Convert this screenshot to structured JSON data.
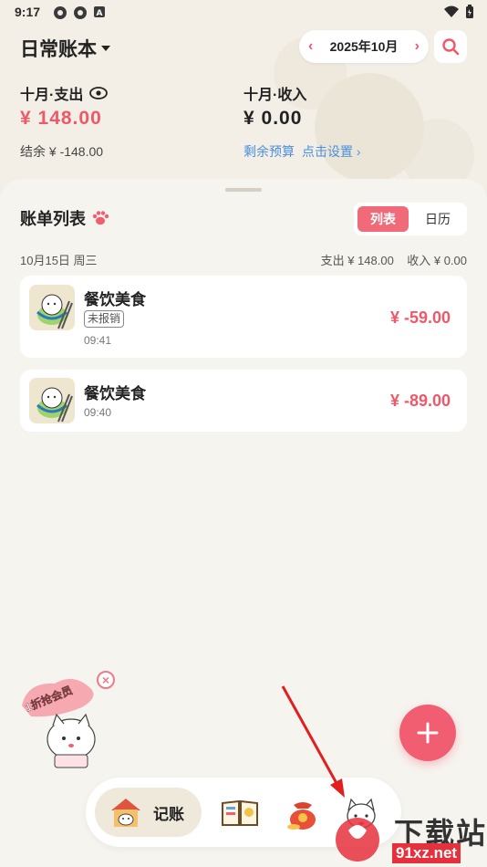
{
  "status_bar": {
    "time": "9:17"
  },
  "header": {
    "book_name": "日常账本",
    "month": "2025年10月"
  },
  "summary": {
    "expense_label": "十月·支出",
    "expense_amount": "¥ 148.00",
    "income_label": "十月·收入",
    "income_amount": "¥ 0.00",
    "balance_text": "结余 ¥ -148.00",
    "budget_link": "剩余预算",
    "budget_action": "点击设置 ›"
  },
  "bill_list": {
    "title": "账单列表",
    "view_tabs": [
      {
        "label": "列表",
        "active": true
      },
      {
        "label": "日历",
        "active": false
      }
    ],
    "date_header": {
      "date": "10月15日 周三",
      "totals": "支出 ¥ 148.00    收入 ¥ 0.00"
    },
    "items": [
      {
        "category": "餐饮美食",
        "tag": "未报销",
        "time": "09:41",
        "amount": "¥ -59.00"
      },
      {
        "category": "餐饮美食",
        "time": "09:40",
        "amount": "¥ -89.00"
      }
    ]
  },
  "promo": {
    "text": "1折抢会员"
  },
  "bottom_nav": {
    "active_label": "记账"
  },
  "watermark": {
    "text": "下载站",
    "url": "91xz.net"
  },
  "colors": {
    "accent": "#f25e71",
    "amount_red": "#f0586a"
  }
}
